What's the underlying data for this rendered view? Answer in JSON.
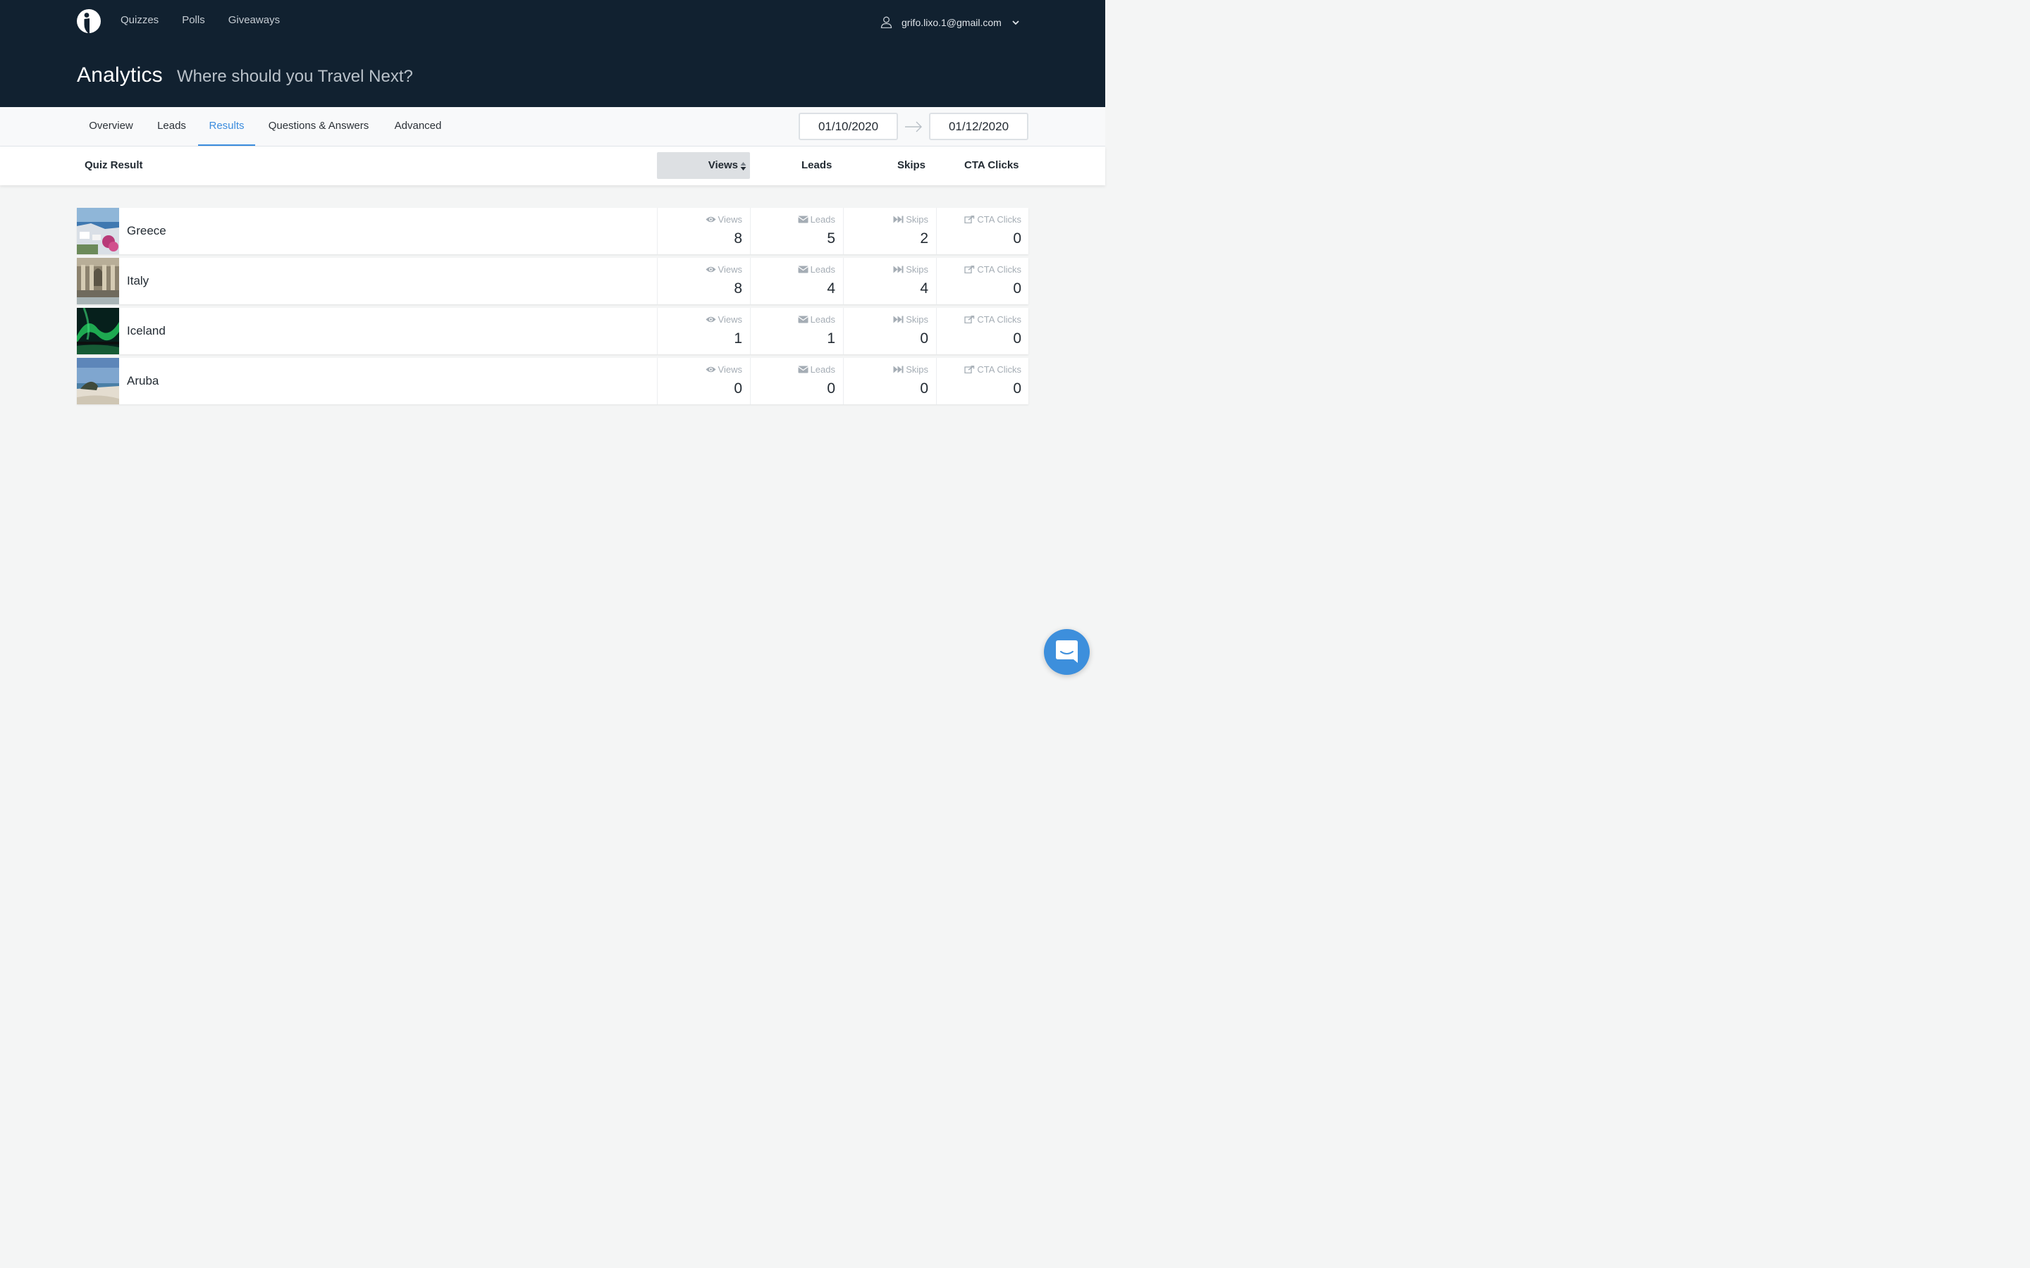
{
  "header": {
    "logo_icon": "interact-logo-icon",
    "nav": [
      "Quizzes",
      "Polls",
      "Giveaways"
    ],
    "account_email": "grifo.lixo.1@gmail.com",
    "title": "Analytics",
    "subtitle": "Where should you Travel Next?",
    "bg_color": "#112130"
  },
  "tabs": {
    "items": [
      "Overview",
      "Leads",
      "Results",
      "Questions & Answers",
      "Advanced"
    ],
    "active": "Results",
    "accent_color": "#3b8cde"
  },
  "date_range": {
    "start": "01/10/2020",
    "end": "01/12/2020"
  },
  "table": {
    "headers": {
      "result": "Quiz Result",
      "views": "Views",
      "leads": "Leads",
      "skips": "Skips",
      "cta": "CTA Clicks"
    },
    "sorted_by": "Views",
    "rows": [
      {
        "name": "Greece",
        "views": "8",
        "leads": "5",
        "skips": "2",
        "cta": "0"
      },
      {
        "name": "Italy",
        "views": "8",
        "leads": "4",
        "skips": "4",
        "cta": "0"
      },
      {
        "name": "Iceland",
        "views": "1",
        "leads": "1",
        "skips": "0",
        "cta": "0"
      },
      {
        "name": "Aruba",
        "views": "0",
        "leads": "0",
        "skips": "0",
        "cta": "0"
      }
    ]
  },
  "chat": {
    "icon": "chat-bubble-icon",
    "color": "#3d8fdc"
  }
}
